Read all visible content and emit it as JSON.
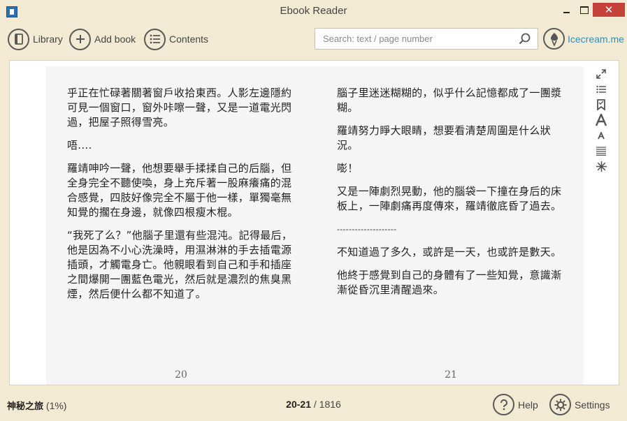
{
  "window": {
    "title": "Ebook Reader",
    "close_glyph": "✕"
  },
  "toolbar": {
    "library_label": "Library",
    "add_book_label": "Add book",
    "contents_label": "Contents"
  },
  "search": {
    "placeholder": "Search: text / page number",
    "value": ""
  },
  "brand": {
    "link_text": "Icecream.me"
  },
  "pages": {
    "left": {
      "number": "20",
      "paragraphs": [
        "乎正在忙碌著關著窗戶收拾東西。人影左邊隱約可見一個窗口，窗外咔嚓一聲，又是一道電光閃過，把屋子照得雪亮。",
        "唔....",
        "羅靖呻吟一聲，他想要舉手揉揉自己的后腦，但全身完全不聽使喚，身上充斥著一股麻癢痛的混合感覺，四肢好像完全不屬于他一樣，單獨毫無知覺的擱在身邊，就像四根瘦木棍。",
        "“我死了么？”他腦子里還有些混沌。記得最后，他是因為不小心洗澡時，用濕淋淋的手去插電源插頭，才觸電身亡。他親眼看到自己和手和插座之間爆開一團藍色電光，然后就是濃烈的焦臭黑煙，然后便什么都不知道了。"
      ]
    },
    "right": {
      "number": "21",
      "paragraphs": [
        "腦子里迷迷糊糊的，似乎什么記憶都成了一團漿糊。",
        "羅靖努力睜大眼睛，想要看清楚周圍是什么狀況。",
        "嘭！",
        "又是一陣劇烈晃動，他的腦袋一下撞在身后的床板上，一陣劇痛再度傳來，羅靖徹底昏了過去。",
        "--------------------",
        "不知道過了多久，或許是一天，也或許是數天。",
        "他終于感覺到自己的身體有了一些知覺，意識漸漸從昏沉里清醒過來。"
      ]
    }
  },
  "side_tools": [
    "fullscreen-icon",
    "list-icon",
    "bookmark-icon",
    "font-increase-icon",
    "font-decrease-icon",
    "justify-icon",
    "brightness-icon"
  ],
  "status": {
    "book_name": "神秘之旅",
    "progress": "(1%)",
    "current_pages": "20-21",
    "total_pages": "/ 1816",
    "help_label": "Help",
    "settings_label": "Settings"
  }
}
